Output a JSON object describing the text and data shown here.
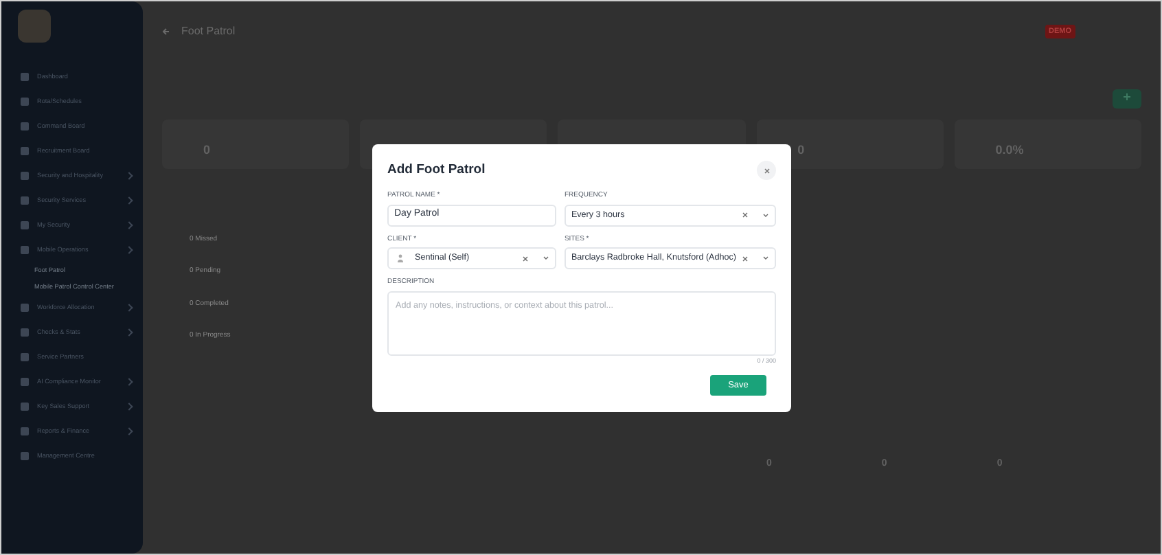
{
  "sidebar": {
    "items": [
      {
        "label": "Dashboard",
        "chevron": false
      },
      {
        "label": "Rota/Schedules",
        "chevron": false
      },
      {
        "label": "Command Board",
        "chevron": false
      },
      {
        "label": "Recruitment Board",
        "chevron": false
      },
      {
        "label": "Security and Hospitality",
        "chevron": true
      },
      {
        "label": "Security Services",
        "chevron": true
      },
      {
        "label": "My Security",
        "chevron": true
      },
      {
        "label": "Mobile Operations",
        "chevron": true,
        "children": [
          {
            "label": "Foot Patrol"
          },
          {
            "label": "Mobile Patrol Control Center"
          }
        ]
      },
      {
        "label": "Workforce Allocation",
        "chevron": true
      },
      {
        "label": "Checks & Stats",
        "chevron": true
      },
      {
        "label": "Service Partners",
        "chevron": false
      },
      {
        "label": "AI Compliance Monitor",
        "chevron": true
      },
      {
        "label": "Key Sales Support",
        "chevron": true
      },
      {
        "label": "Reports & Finance",
        "chevron": true
      },
      {
        "label": "Management Centre",
        "chevron": false
      }
    ]
  },
  "header": {
    "title": "Foot Patrol",
    "badge": "DEMO"
  },
  "stats": [
    "0",
    "0",
    "0.0%"
  ],
  "status_list": [
    "0 Missed",
    "0 Pending",
    "0 Completed",
    "0 In Progress"
  ],
  "bottom_counts": [
    "0",
    "0",
    "0"
  ],
  "modal": {
    "title": "Add Foot Patrol",
    "fields": [
      {
        "kind": "input",
        "label": "PATROL NAME *",
        "value": "Day Patrol"
      },
      {
        "kind": "select",
        "label": "FREQUENCY",
        "value": "Every 3 hours",
        "person": false
      },
      {
        "kind": "select",
        "label": "CLIENT *",
        "value": "Sentinal (Self)",
        "person": true
      },
      {
        "kind": "select",
        "label": "SITES *",
        "value": "Barclays Radbroke Hall, Knutsford (Adhoc)",
        "person": false
      },
      {
        "kind": "textarea",
        "label": "DESCRIPTION",
        "placeholder": "Add any notes, instructions, or context about this patrol...",
        "counter": "0 / 300"
      }
    ],
    "save": "Save"
  }
}
